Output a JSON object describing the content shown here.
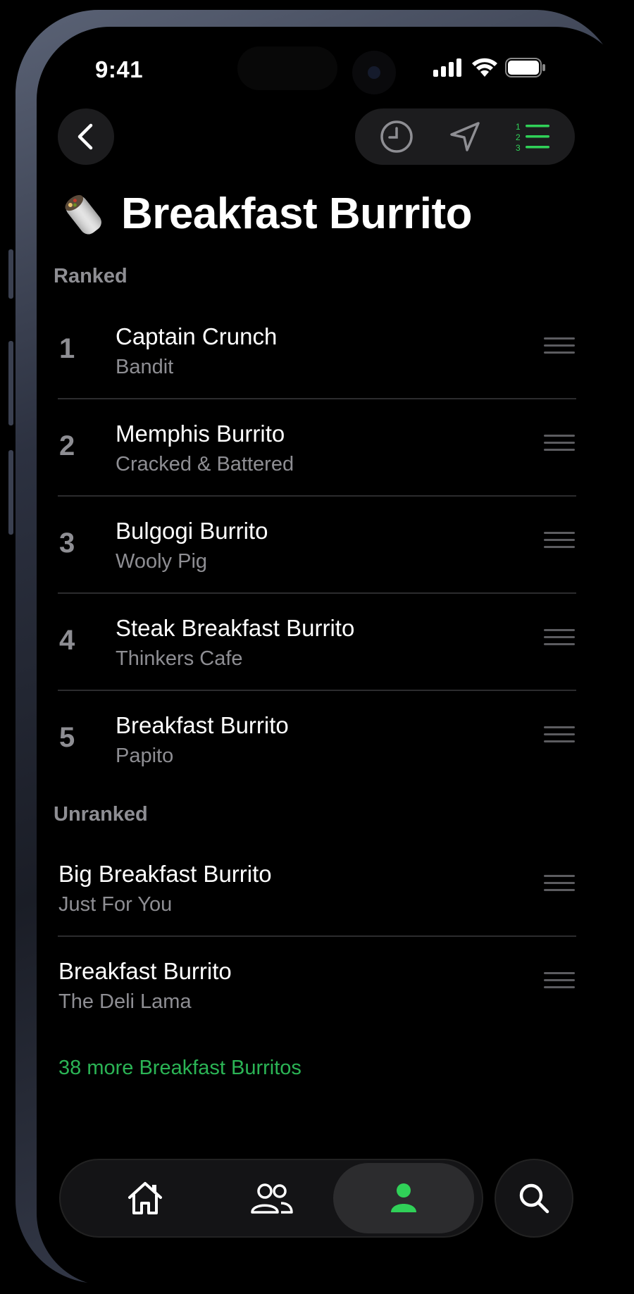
{
  "status_bar": {
    "time": "9:41"
  },
  "header": {
    "back_icon": "chevron-left-icon",
    "segments": [
      "clock-icon",
      "navigation-arrow-icon",
      "numbered-list-icon"
    ],
    "active_segment": "numbered-list-icon",
    "title": "Breakfast Burrito",
    "accent_color": "#30d158"
  },
  "ranked": {
    "label": "Ranked",
    "items": [
      {
        "rank": "1",
        "name": "Captain Crunch",
        "place": "Bandit"
      },
      {
        "rank": "2",
        "name": "Memphis Burrito",
        "place": "Cracked & Battered"
      },
      {
        "rank": "3",
        "name": "Bulgogi Burrito",
        "place": "Wooly Pig"
      },
      {
        "rank": "4",
        "name": "Steak Breakfast Burrito",
        "place": "Thinkers Cafe"
      },
      {
        "rank": "5",
        "name": "Breakfast Burrito",
        "place": "Papito"
      }
    ]
  },
  "unranked": {
    "label": "Unranked",
    "items": [
      {
        "name": "Big Breakfast Burrito",
        "place": "Just For You"
      },
      {
        "name": "Breakfast Burrito",
        "place": "The Deli Lama"
      }
    ]
  },
  "more_link": "38 more Breakfast Burritos",
  "tab_bar": {
    "tabs": [
      "home-icon",
      "people-icon",
      "person-icon"
    ],
    "active_tab": "person-icon",
    "search": "search-icon"
  }
}
